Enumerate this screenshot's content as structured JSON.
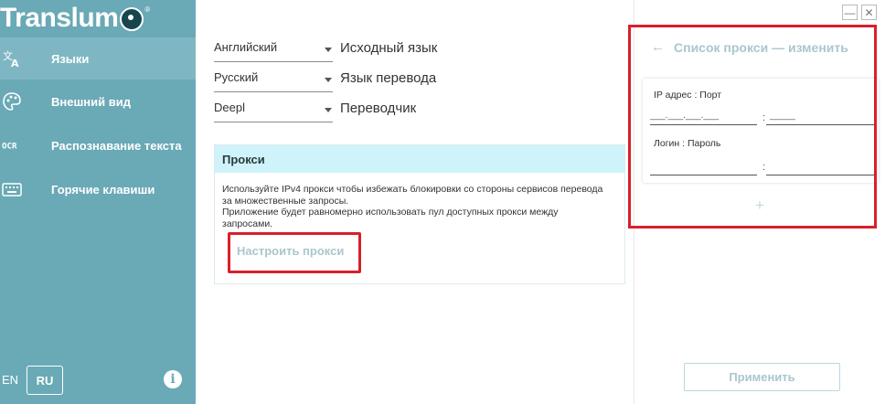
{
  "app": {
    "logo_text": "Translum",
    "logo_mark": "®"
  },
  "sidebar": {
    "items": [
      {
        "label": "Языки",
        "icon": "translate-icon",
        "active": true
      },
      {
        "label": "Внешний вид",
        "icon": "palette-icon",
        "active": false
      },
      {
        "label": "Распознавание текста",
        "icon": "ocr-icon",
        "active": false
      },
      {
        "label": "Горячие клавиши",
        "icon": "keyboard-icon",
        "active": false
      }
    ],
    "lang_en": "EN",
    "lang_ru": "RU",
    "info_glyph": "i"
  },
  "main": {
    "selects": [
      {
        "value": "Английский",
        "label": "Исходный язык"
      },
      {
        "value": "Русский",
        "label": "Язык перевода"
      },
      {
        "value": "Deepl",
        "label": "Переводчик"
      }
    ],
    "proxy": {
      "title": "Прокси",
      "description": "Используйте IPv4 прокси чтобы избежать блокировки со стороны сервисов перевода за множественные запросы.\nПриложение будет равномерно использовать пул доступных прокси между запросами.",
      "button": "Настроить прокси"
    }
  },
  "window": {
    "minimize": "—",
    "close": "✕"
  },
  "right_panel": {
    "back": "←",
    "title": "Список прокси — изменить",
    "ip_label": "IP адрес : Порт",
    "ip_mask": "___.___.___.___",
    "port_mask": "_____",
    "sep": ":",
    "login_label": "Логин : Пароль",
    "add": "+",
    "apply": "Применить"
  },
  "colors": {
    "sidebar": "#6aa9b6",
    "sidebar_active": "#7eb7c3",
    "proxy_header": "#cff3fa",
    "accent_muted": "#a9c7cd",
    "highlight": "#d8202b"
  }
}
